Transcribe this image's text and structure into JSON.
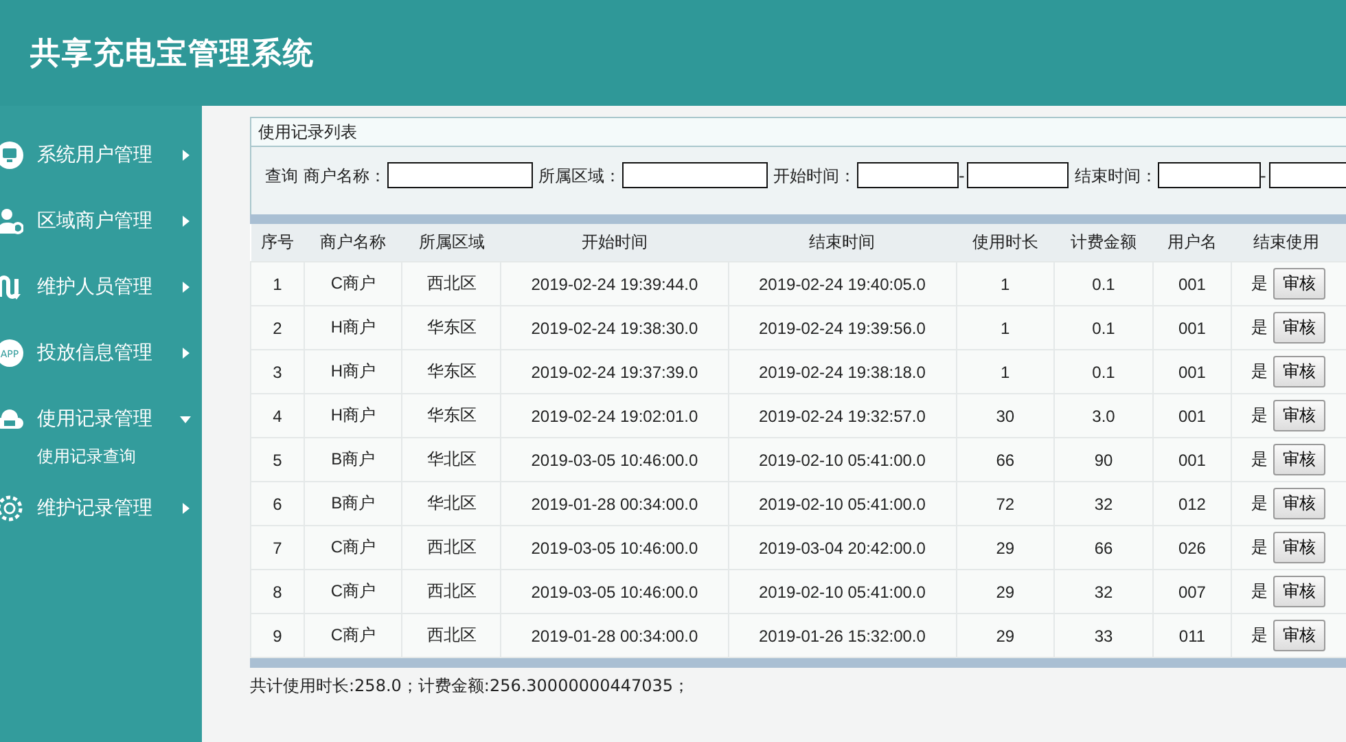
{
  "app_title": "共享充电宝管理系统",
  "sidebar": {
    "items": [
      {
        "label": "系统用户管理",
        "kind": "monitor",
        "expanded": false
      },
      {
        "label": "区域商户管理",
        "kind": "usergear",
        "expanded": false
      },
      {
        "label": "维护人员管理",
        "kind": "route",
        "expanded": false
      },
      {
        "label": "投放信息管理",
        "kind": "app",
        "icon_text": "APP",
        "expanded": false
      },
      {
        "label": "使用记录管理",
        "kind": "cloud",
        "expanded": true,
        "children": [
          {
            "label": "使用记录查询"
          }
        ]
      },
      {
        "label": "维护记录管理",
        "kind": "gear",
        "expanded": false
      }
    ]
  },
  "panel": {
    "title": "使用记录列表",
    "search": {
      "prefix": "查询",
      "filters": [
        {
          "label": "商户名称：",
          "kind": "single"
        },
        {
          "label": "所属区域：",
          "kind": "single"
        },
        {
          "label": "开始时间：",
          "kind": "range",
          "separator": "-"
        },
        {
          "label": "结束时间：",
          "kind": "range",
          "separator": "-"
        }
      ]
    },
    "table": {
      "columns": [
        "序号",
        "商户名称",
        "所属区域",
        "开始时间",
        "结束时间",
        "使用时长",
        "计费金额",
        "用户名",
        "结束使用"
      ],
      "rows": [
        {
          "cells": [
            "1",
            "C商户",
            "西北区",
            "2019-02-24 19:39:44.0",
            "2019-02-24 19:40:05.0",
            "1",
            "0.1",
            "001"
          ],
          "ended": "是",
          "action": "审核"
        },
        {
          "cells": [
            "2",
            "H商户",
            "华东区",
            "2019-02-24 19:38:30.0",
            "2019-02-24 19:39:56.0",
            "1",
            "0.1",
            "001"
          ],
          "ended": "是",
          "action": "审核"
        },
        {
          "cells": [
            "3",
            "H商户",
            "华东区",
            "2019-02-24 19:37:39.0",
            "2019-02-24 19:38:18.0",
            "1",
            "0.1",
            "001"
          ],
          "ended": "是",
          "action": "审核"
        },
        {
          "cells": [
            "4",
            "H商户",
            "华东区",
            "2019-02-24 19:02:01.0",
            "2019-02-24 19:32:57.0",
            "30",
            "3.0",
            "001"
          ],
          "ended": "是",
          "action": "审核"
        },
        {
          "cells": [
            "5",
            "B商户",
            "华北区",
            "2019-03-05 10:46:00.0",
            "2019-02-10 05:41:00.0",
            "66",
            "90",
            "001"
          ],
          "ended": "是",
          "action": "审核"
        },
        {
          "cells": [
            "6",
            "B商户",
            "华北区",
            "2019-01-28 00:34:00.0",
            "2019-02-10 05:41:00.0",
            "72",
            "32",
            "012"
          ],
          "ended": "是",
          "action": "审核"
        },
        {
          "cells": [
            "7",
            "C商户",
            "西北区",
            "2019-03-05 10:46:00.0",
            "2019-03-04 20:42:00.0",
            "29",
            "66",
            "026"
          ],
          "ended": "是",
          "action": "审核"
        },
        {
          "cells": [
            "8",
            "C商户",
            "西北区",
            "2019-03-05 10:46:00.0",
            "2019-02-10 05:41:00.0",
            "29",
            "32",
            "007"
          ],
          "ended": "是",
          "action": "审核"
        },
        {
          "cells": [
            "9",
            "C商户",
            "西北区",
            "2019-01-28 00:34:00.0",
            "2019-01-26 15:32:00.0",
            "29",
            "33",
            "011"
          ],
          "ended": "是",
          "action": "审核"
        }
      ]
    }
  },
  "summary": "共计使用时长:258.0；计费金额:256.30000000447035；"
}
